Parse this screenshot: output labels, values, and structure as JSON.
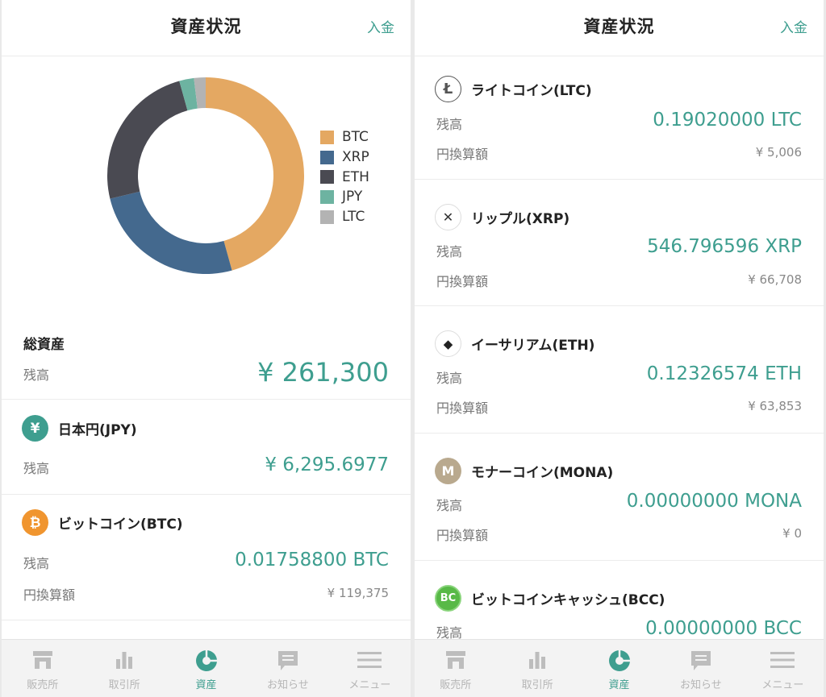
{
  "colors": {
    "accent": "#3e9e8f",
    "btc": "#e4a862",
    "xrp": "#44698e",
    "eth": "#4a4a52",
    "jpy": "#6db3a1",
    "ltc": "#b3b3b3"
  },
  "left": {
    "header": {
      "title": "資産状況",
      "action": "入金"
    },
    "chart_data": {
      "type": "pie",
      "labels": [
        "BTC",
        "XRP",
        "ETH",
        "JPY",
        "LTC"
      ],
      "values": [
        119375,
        66708,
        63853,
        6296,
        5006
      ]
    },
    "total": {
      "title": "総資産",
      "balance_label": "残高",
      "balance": "¥ 261,300"
    },
    "assets": [
      {
        "icon": "yen-icon",
        "icon_glyph": "¥",
        "name": "日本円(JPY)",
        "balance_label": "残高",
        "balance": "¥ 6,295.6977"
      },
      {
        "icon": "bitcoin-icon",
        "icon_glyph": "₿",
        "name": "ビットコイン(BTC)",
        "balance_label": "残高",
        "balance": "0.01758800 BTC",
        "yen_label": "円換算額",
        "yen": "¥ 119,375"
      }
    ]
  },
  "right": {
    "header": {
      "title": "資産状況",
      "action": "入金"
    },
    "assets": [
      {
        "icon": "litecoin-icon",
        "icon_glyph": "Ł",
        "name": "ライトコイン(LTC)",
        "balance_label": "残高",
        "balance": "0.19020000 LTC",
        "yen_label": "円換算額",
        "yen": "¥ 5,006"
      },
      {
        "icon": "ripple-icon",
        "icon_glyph": "✕",
        "name": "リップル(XRP)",
        "balance_label": "残高",
        "balance": "546.796596 XRP",
        "yen_label": "円換算額",
        "yen": "¥ 66,708"
      },
      {
        "icon": "ethereum-icon",
        "icon_glyph": "◆",
        "name": "イーサリアム(ETH)",
        "balance_label": "残高",
        "balance": "0.12326574 ETH",
        "yen_label": "円換算額",
        "yen": "¥ 63,853"
      },
      {
        "icon": "monacoin-icon",
        "icon_glyph": "M",
        "name": "モナーコイン(MONA)",
        "balance_label": "残高",
        "balance": "0.00000000 MONA",
        "yen_label": "円換算額",
        "yen": "¥ 0"
      },
      {
        "icon": "bitcoin-cash-icon",
        "icon_glyph": "BC",
        "name": "ビットコインキャッシュ(BCC)",
        "balance_label": "残高",
        "balance": "0.00000000 BCC"
      }
    ]
  },
  "tabbar": {
    "tabs": [
      {
        "label": "販売所",
        "icon": "store-icon",
        "active": false
      },
      {
        "label": "取引所",
        "icon": "bar-chart-icon",
        "active": false
      },
      {
        "label": "資産",
        "icon": "pie-chart-icon",
        "active": true
      },
      {
        "label": "お知らせ",
        "icon": "message-icon",
        "active": false
      },
      {
        "label": "メニュー",
        "icon": "hamburger-menu-icon",
        "active": false
      }
    ]
  }
}
